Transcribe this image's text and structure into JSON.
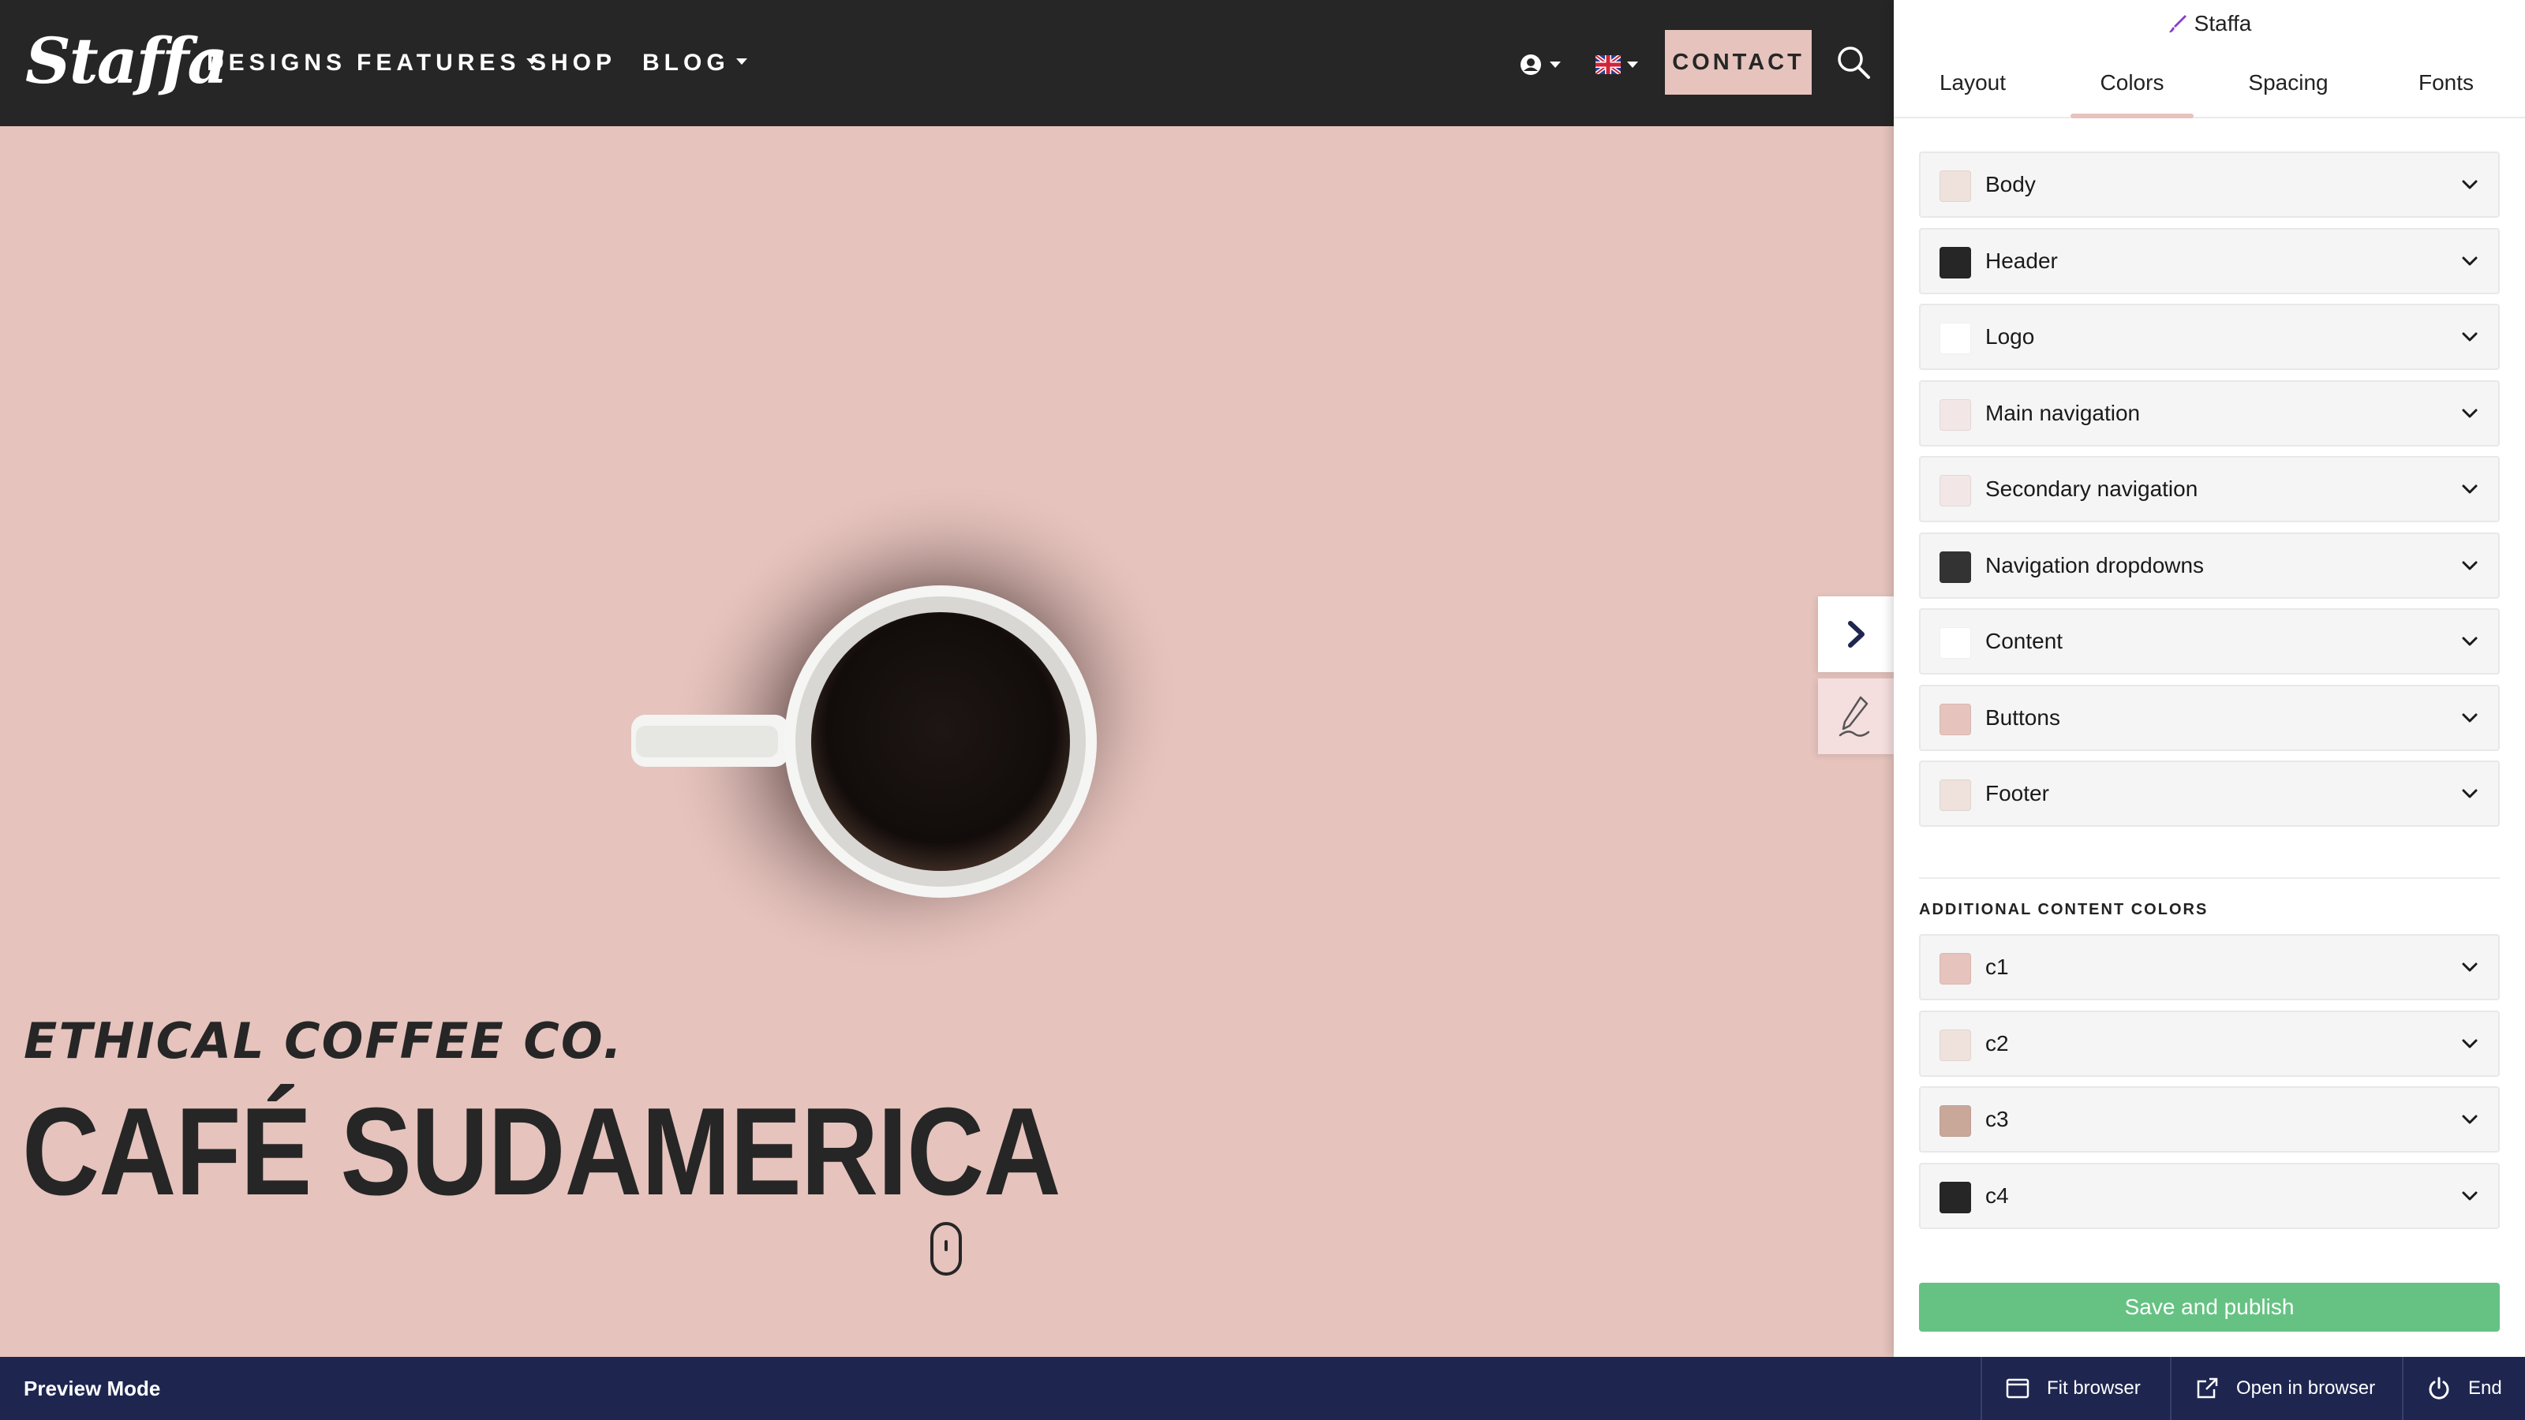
{
  "site": {
    "logo": "Staffa",
    "nav": [
      {
        "label": "DESIGNS",
        "dropdown": false
      },
      {
        "label": "FEATURES",
        "dropdown": true
      },
      {
        "label": "SHOP",
        "dropdown": false
      },
      {
        "label": "BLOG",
        "dropdown": true
      }
    ],
    "contact_label": "CONTACT",
    "hero": {
      "subtitle": "ETHICAL COFFEE CO.",
      "title": "CAFÉ SUDAMERICA"
    },
    "icons": {
      "account": "user-circle-icon",
      "language": "uk-flag-icon",
      "search": "search-icon",
      "scroll": "mouse-scroll-icon",
      "toggle": "chevron-right-icon",
      "edit": "pencil-icon"
    }
  },
  "panel": {
    "title": "Staffa",
    "tabs": [
      "Layout",
      "Colors",
      "Spacing",
      "Fonts"
    ],
    "active_tab": "Colors",
    "color_rows": [
      {
        "label": "Body",
        "swatch": "#efe2dc"
      },
      {
        "label": "Header",
        "swatch": "#262626"
      },
      {
        "label": "Logo",
        "swatch": "#ffffff"
      },
      {
        "label": "Main navigation",
        "swatch": "#f2e6e6"
      },
      {
        "label": "Secondary navigation",
        "swatch": "#f2e6e6"
      },
      {
        "label": "Navigation dropdowns",
        "swatch": "#333333"
      },
      {
        "label": "Content",
        "swatch": "#ffffff"
      },
      {
        "label": "Buttons",
        "swatch": "#e6c3bd"
      },
      {
        "label": "Footer",
        "swatch": "#efe2dc"
      }
    ],
    "additional_section_label": "ADDITIONAL CONTENT COLORS",
    "additional_rows": [
      {
        "label": "c1",
        "swatch": "#e6c3bd"
      },
      {
        "label": "c2",
        "swatch": "#efe2dc"
      },
      {
        "label": "c3",
        "swatch": "#c9a89a"
      },
      {
        "label": "c4",
        "swatch": "#262626"
      }
    ],
    "save_label": "Save and publish"
  },
  "bottom_bar": {
    "mode_label": "Preview Mode",
    "fit_label": "Fit browser",
    "open_label": "Open in browser",
    "end_label": "End"
  },
  "colors": {
    "header_bg": "#262626",
    "page_bg": "#e6c3bd",
    "accent": "#e6c3bd",
    "save_green": "#66c283",
    "bottom_bar_bg": "#1e2650"
  }
}
